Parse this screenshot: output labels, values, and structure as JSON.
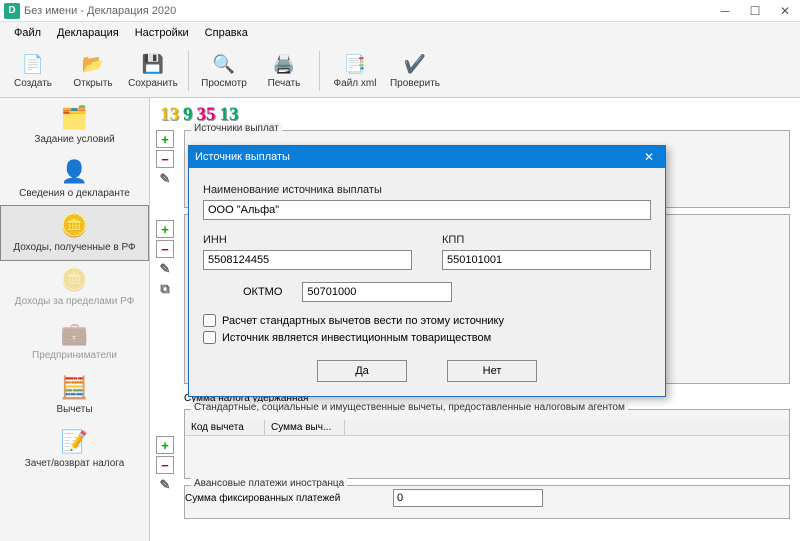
{
  "window": {
    "title": "Без имени - Декларация 2020"
  },
  "menu": {
    "file": "Файл",
    "decl": "Декларация",
    "settings": "Настройки",
    "help": "Справка"
  },
  "toolbar": {
    "create": "Создать",
    "open": "Открыть",
    "save": "Сохранить",
    "preview": "Просмотр",
    "print": "Печать",
    "xml": "Файл xml",
    "check": "Проверить"
  },
  "sidebar": {
    "conditions": "Задание условий",
    "declarant": "Сведения о декларанте",
    "income_rf": "Доходы, полученные в РФ",
    "income_abroad": "Доходы за пределами РФ",
    "entrepreneurs": "Предприниматели",
    "deductions": "Вычеты",
    "offset": "Зачет/возврат налога"
  },
  "rates": {
    "r13a": "13",
    "r9": "9",
    "r35": "35",
    "r13b": "13"
  },
  "panels": {
    "sources": "Источники выплат",
    "tax_withheld": "Сумма налога удержанная",
    "standard_deductions": "Стандартные, социальные и имущественные вычеты, предоставленные налоговым агентом",
    "code_col": "Код вычета",
    "sum_col": "Сумма выч...",
    "advance": "Авансовые платежи иностранца",
    "fixed_sum_label": "Сумма фиксированных платежей",
    "fixed_sum_value": "0"
  },
  "dialog": {
    "title": "Источник выплаты",
    "name_label": "Наименование источника выплаты",
    "name_value": "ООО \"Альфа\"",
    "inn_label": "ИНН",
    "inn_value": "5508124455",
    "kpp_label": "КПП",
    "kpp_value": "550101001",
    "oktmo_label": "ОКТМО",
    "oktmo_value": "50701000",
    "chk1": "Расчет стандартных вычетов вести по этому источнику",
    "chk2": "Источник является инвестиционным товариществом",
    "yes": "Да",
    "no": "Нет"
  }
}
